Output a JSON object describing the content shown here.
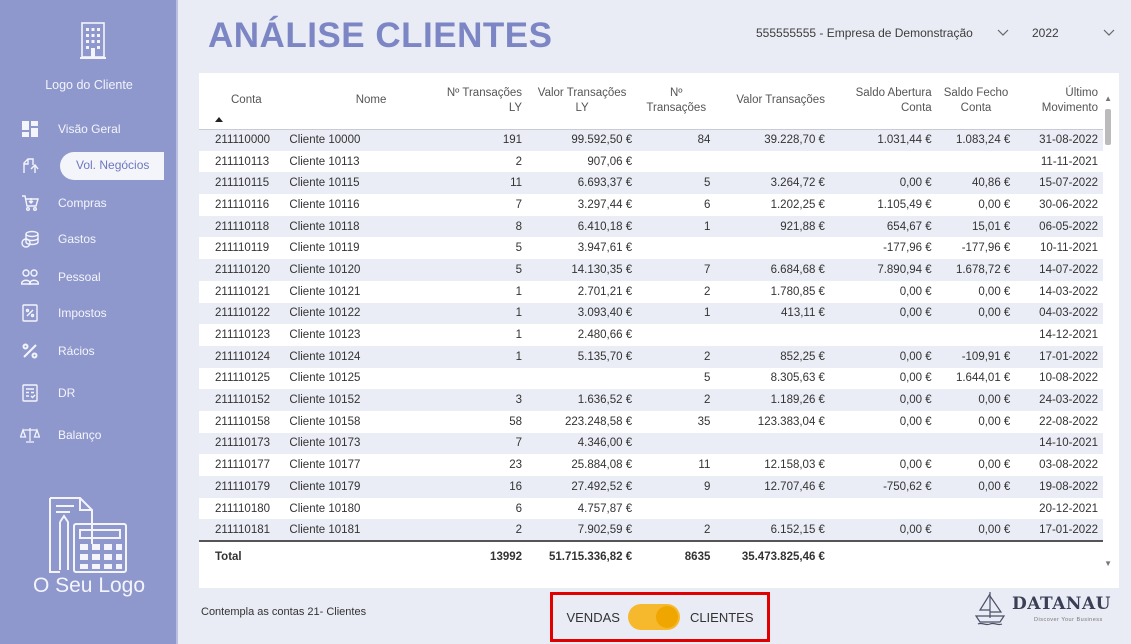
{
  "sidebar": {
    "client_logo_text": "Logo do Cliente",
    "brand_text": "O Seu Logo",
    "items": [
      {
        "label": "Visão Geral",
        "icon": "dashboard-icon",
        "active": false
      },
      {
        "label": "Vol. Negócios",
        "icon": "sales-hand-icon",
        "active": true
      },
      {
        "label": "Compras",
        "icon": "cart-icon",
        "active": false
      },
      {
        "label": "Gastos",
        "icon": "coins-icon",
        "active": false
      },
      {
        "label": "Pessoal",
        "icon": "people-icon",
        "active": false
      },
      {
        "label": "Impostos",
        "icon": "tax-icon",
        "active": false
      },
      {
        "label": "Rácios",
        "icon": "percent-icon",
        "active": false
      },
      {
        "label": "DR",
        "icon": "report-icon",
        "active": false
      },
      {
        "label": "Balanço",
        "icon": "balance-scale-icon",
        "active": false
      }
    ]
  },
  "header": {
    "title": "ANÁLISE CLIENTES",
    "company": "555555555 - Empresa de Demonstração",
    "year": "2022"
  },
  "table": {
    "columns": {
      "conta": "Conta",
      "nome": "Nome",
      "tr_ly": "Nº Transações LY",
      "vt_ly": "Valor Transações LY",
      "tr": "Nº Transações",
      "vt": "Valor Transações",
      "sa": "Saldo Abertura Conta",
      "sf": "Saldo Fecho Conta",
      "um": "Último Movimento"
    },
    "rows": [
      [
        "211110000",
        "Cliente 10000",
        "191",
        "99.592,50 €",
        "84",
        "39.228,70 €",
        "1.031,44 €",
        "1.083,24 €",
        "31-08-2022"
      ],
      [
        "211110113",
        "Cliente 10113",
        "2",
        "907,06 €",
        "",
        "",
        "",
        "",
        "11-11-2021"
      ],
      [
        "211110115",
        "Cliente 10115",
        "11",
        "6.693,37 €",
        "5",
        "3.264,72 €",
        "0,00 €",
        "40,86 €",
        "15-07-2022"
      ],
      [
        "211110116",
        "Cliente 10116",
        "7",
        "3.297,44 €",
        "6",
        "1.202,25 €",
        "1.105,49 €",
        "0,00 €",
        "30-06-2022"
      ],
      [
        "211110118",
        "Cliente 10118",
        "8",
        "6.410,18 €",
        "1",
        "921,88 €",
        "654,67 €",
        "15,01 €",
        "06-05-2022"
      ],
      [
        "211110119",
        "Cliente 10119",
        "5",
        "3.947,61 €",
        "",
        "",
        "-177,96 €",
        "-177,96 €",
        "10-11-2021"
      ],
      [
        "211110120",
        "Cliente 10120",
        "5",
        "14.130,35 €",
        "7",
        "6.684,68 €",
        "7.890,94 €",
        "1.678,72 €",
        "14-07-2022"
      ],
      [
        "211110121",
        "Cliente 10121",
        "1",
        "2.701,21 €",
        "2",
        "1.780,85 €",
        "0,00 €",
        "0,00 €",
        "14-03-2022"
      ],
      [
        "211110122",
        "Cliente 10122",
        "1",
        "3.093,40 €",
        "1",
        "413,11 €",
        "0,00 €",
        "0,00 €",
        "04-03-2022"
      ],
      [
        "211110123",
        "Cliente 10123",
        "1",
        "2.480,66 €",
        "",
        "",
        "",
        "",
        "14-12-2021"
      ],
      [
        "211110124",
        "Cliente 10124",
        "1",
        "5.135,70 €",
        "2",
        "852,25 €",
        "0,00 €",
        "-109,91 €",
        "17-01-2022"
      ],
      [
        "211110125",
        "Cliente 10125",
        "",
        "",
        "5",
        "8.305,63 €",
        "0,00 €",
        "1.644,01 €",
        "10-08-2022"
      ],
      [
        "211110152",
        "Cliente 10152",
        "3",
        "1.636,52 €",
        "2",
        "1.189,26 €",
        "0,00 €",
        "0,00 €",
        "24-03-2022"
      ],
      [
        "211110158",
        "Cliente 10158",
        "58",
        "223.248,58 €",
        "35",
        "123.383,04 €",
        "0,00 €",
        "0,00 €",
        "22-08-2022"
      ],
      [
        "211110173",
        "Cliente 10173",
        "7",
        "4.346,00 €",
        "",
        "",
        "",
        "",
        "14-10-2021"
      ],
      [
        "211110177",
        "Cliente 10177",
        "23",
        "25.884,08 €",
        "11",
        "12.158,03 €",
        "0,00 €",
        "0,00 €",
        "03-08-2022"
      ],
      [
        "211110179",
        "Cliente 10179",
        "16",
        "27.492,52 €",
        "9",
        "12.707,46 €",
        "-750,62 €",
        "0,00 €",
        "19-08-2022"
      ],
      [
        "211110180",
        "Cliente 10180",
        "6",
        "4.757,87 €",
        "",
        "",
        "",
        "",
        "20-12-2021"
      ],
      [
        "211110181",
        "Cliente 10181",
        "2",
        "7.902,59 €",
        "2",
        "6.152,15 €",
        "0,00 €",
        "0,00 €",
        "17-01-2022"
      ]
    ],
    "total": {
      "label": "Total",
      "tr_ly": "13992",
      "vt_ly": "51.715.336,82 €",
      "tr": "8635",
      "vt": "35.473.825,46 €"
    }
  },
  "footer": {
    "note": "Contempla as contas 21- Clientes",
    "toggle_left": "VENDAS",
    "toggle_right": "CLIENTES",
    "brand": "DATANAU",
    "brand_tagline": "Discover Your Business"
  },
  "colors": {
    "sidebar": "#8f98cc",
    "title": "#7c86c4",
    "toggle": "#f6b92d",
    "highlight_border": "#e00000"
  }
}
